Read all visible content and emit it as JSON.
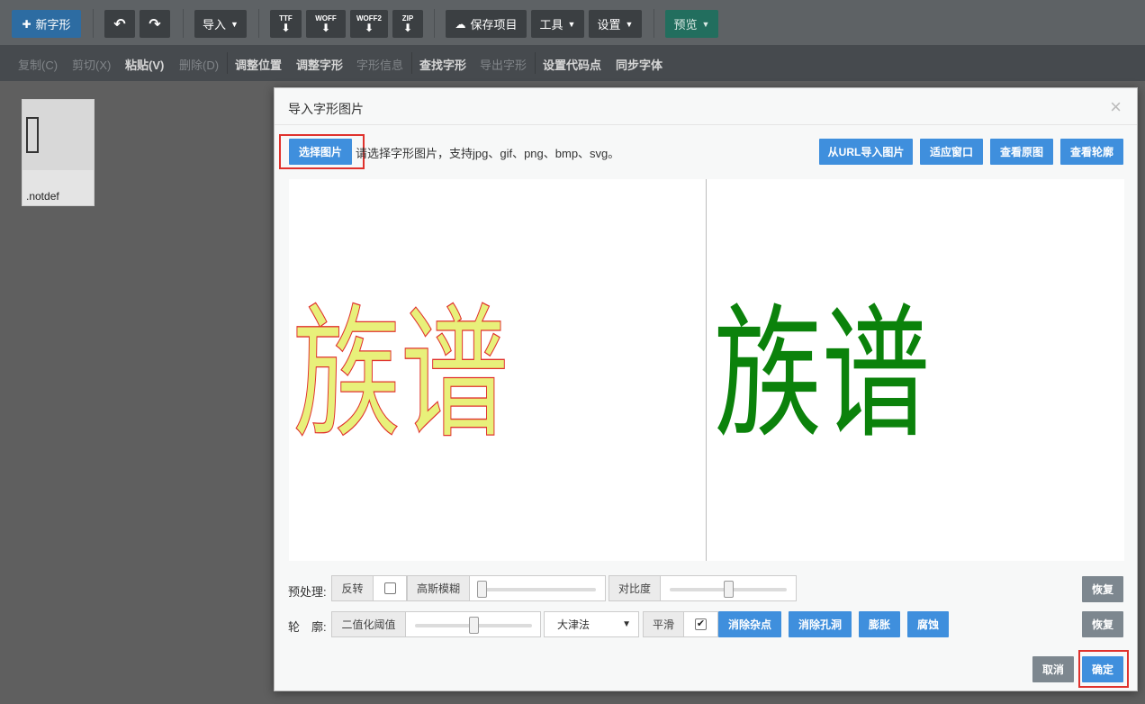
{
  "toolbar": {
    "new_glyph": "新字形",
    "undo_icon": "↶",
    "redo_icon": "↷",
    "import": "导入",
    "formats": [
      "TTF",
      "WOFF",
      "WOFF2",
      "ZIP"
    ],
    "save_project": "保存项目",
    "tools": "工具",
    "settings": "设置",
    "preview": "预览"
  },
  "subtoolbar": {
    "copy": "复制(C)",
    "cut": "剪切(X)",
    "paste": "粘贴(V)",
    "delete": "删除(D)",
    "adjust_position": "调整位置",
    "adjust_glyph": "调整字形",
    "glyph_info": "字形信息",
    "find_glyph": "查找字形",
    "export_glyph": "导出字形",
    "set_codepoint": "设置代码点",
    "sync_font": "同步字体"
  },
  "glyph_list": [
    {
      "name": ".notdef"
    }
  ],
  "dialog": {
    "title": "导入字形图片",
    "close": "×",
    "select_image": "选择图片",
    "hint": "请选择字形图片，支持jpg、gif、png、bmp、svg。",
    "import_url": "从URL导入图片",
    "fit_window": "适应窗口",
    "view_original": "查看原图",
    "view_outline": "查看轮廓",
    "image_text": "族谱",
    "preprocess": {
      "label": "预处理:",
      "invert": "反转",
      "invert_checked": false,
      "gaussian_blur": "高斯模糊",
      "gaussian_blur_level": 0.02,
      "contrast": "对比度",
      "contrast_level": 0.5,
      "reset": "恢复"
    },
    "outline": {
      "label": "轮　廓:",
      "threshold": "二值化阈值",
      "threshold_level": 0.5,
      "method": "大津法",
      "smooth": "平滑",
      "smooth_checked": true,
      "smooth_mark": "✔",
      "denoise": "消除杂点",
      "fill_holes": "消除孔洞",
      "dilate": "膨胀",
      "erode": "腐蚀",
      "reset": "恢复"
    },
    "cancel": "取消",
    "confirm": "确定"
  },
  "colors": {
    "outline_fill": "#e8f07a",
    "outline_stroke": "#e0322d",
    "result_fill": "#0b820b",
    "accent": "#3f8fdd",
    "highlight": "#e0322d"
  }
}
